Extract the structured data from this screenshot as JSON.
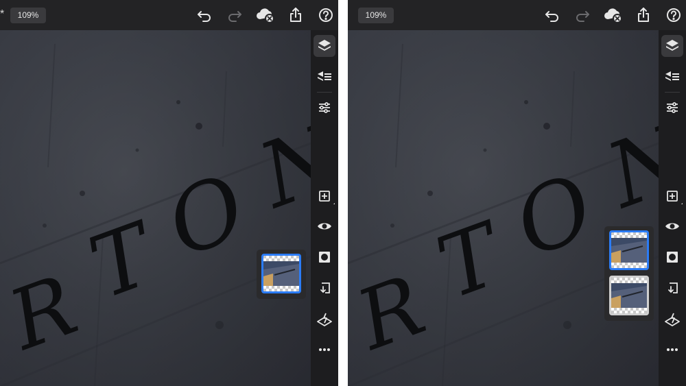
{
  "panels": [
    {
      "id": "left",
      "show_asterisk": true,
      "asterisk": "*",
      "zoom_label": "109%",
      "layers": [
        {
          "name": "layer-1",
          "selected": true
        }
      ]
    },
    {
      "id": "right",
      "show_asterisk": false,
      "asterisk": "",
      "zoom_label": "109%",
      "layers": [
        {
          "name": "layer-1",
          "selected": true
        },
        {
          "name": "layer-2",
          "selected": false
        }
      ]
    }
  ],
  "toolbar_icons": [
    "undo-icon",
    "redo-icon",
    "cloud-sync-error-icon",
    "share-icon",
    "help-icon"
  ],
  "rail_icons": [
    "layers-icon",
    "layer-properties-icon",
    "adjustments-icon",
    "add-layer-icon",
    "visibility-icon",
    "mask-icon",
    "merge-down-icon",
    "clear-layer-icon",
    "more-icon"
  ],
  "canvas_letters": [
    "R",
    "T",
    "O",
    "N"
  ],
  "colors": {
    "accent": "#2b7cf6",
    "toolbar_bg": "#232325",
    "rail_bg": "#1d1d1f",
    "active_button_bg": "#3a3a3d",
    "icon": "#e6e6e6"
  }
}
